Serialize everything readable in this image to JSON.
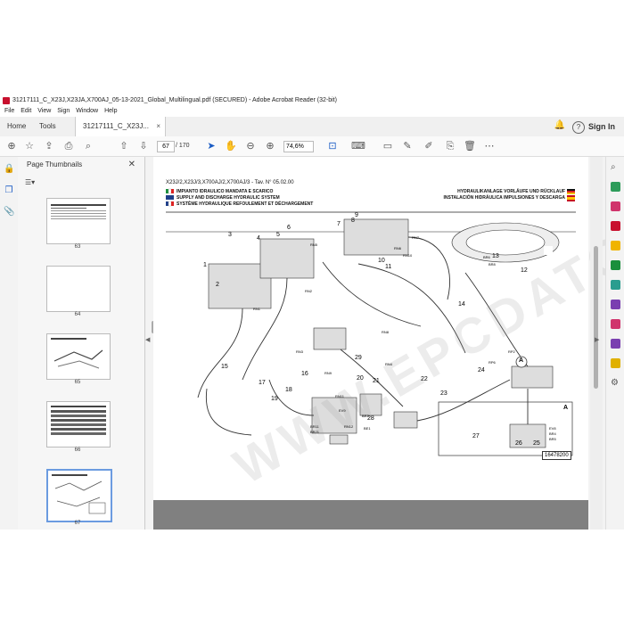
{
  "titlebar": {
    "title": "31217111_C_X23J,X23JA,X700AJ_05-13-2021_Global_Multilingual.pdf (SECURED) - Adobe Acrobat Reader (32-bit)"
  },
  "menu": [
    "File",
    "Edit",
    "View",
    "Sign",
    "Window",
    "Help"
  ],
  "tabs": {
    "home": "Home",
    "tools": "Tools",
    "doc": "31217111_C_X23J..."
  },
  "signin": "Sign In",
  "toolbar": {
    "page_current": "67",
    "page_total": "/ 170",
    "zoom": "74,6%"
  },
  "thumbnails_panel": {
    "title": "Page Thumbnails",
    "pages": [
      "63",
      "64",
      "65",
      "66",
      "67"
    ]
  },
  "document": {
    "header": "X23J/2,X23J/3,X700AJ/2,X700AJ/3 - Tav. N° 05.02.00",
    "titles_left": [
      "IMPIANTO IDRAULICO MANDATA E SCARICO",
      "SUPPLY AND DISCHARGE HYDRAULIC SYSTEM",
      "SYSTÈME HYDRAULIQUE REFOULEMENT ET DÉCHARGEMENT"
    ],
    "titles_right": [
      "HYDRAULIKANLAGE VORLÄUFE UND RÜCKLAUF",
      "INSTALACIÓN HIDRÁULICA IMPULSIONES Y DESCARGA"
    ],
    "detail_label": "A",
    "drawing_code": "16478200",
    "watermark": "WWW.EPCDATO.COM",
    "callouts": [
      "1",
      "2",
      "3",
      "4",
      "5",
      "6",
      "7",
      "8",
      "9",
      "10",
      "11",
      "12",
      "13",
      "14",
      "15",
      "16",
      "17",
      "18",
      "19",
      "20",
      "21",
      "22",
      "23",
      "24",
      "25",
      "26",
      "27",
      "28",
      "29"
    ],
    "port_labels": [
      "RN1",
      "RN2",
      "RN3",
      "RN4",
      "RN5",
      "RN6",
      "RN7",
      "RN8",
      "RN9",
      "RN10",
      "RN11",
      "RN12",
      "EV8",
      "EV9",
      "BR4",
      "BR5",
      "BR6",
      "BR3",
      "BE1",
      "BR8",
      "BR11",
      "BR21",
      "RP2",
      "RP6"
    ]
  },
  "colors": {
    "accent": "#1a5bc4",
    "acrobat_red": "#c8102e",
    "doc_bg": "#808080"
  }
}
